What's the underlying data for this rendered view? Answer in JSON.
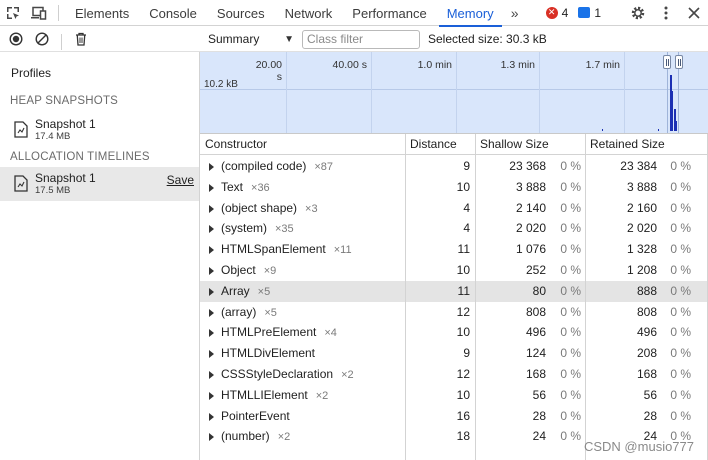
{
  "tabs": [
    {
      "label": "Elements"
    },
    {
      "label": "Console"
    },
    {
      "label": "Sources"
    },
    {
      "label": "Network"
    },
    {
      "label": "Performance"
    },
    {
      "label": "Memory",
      "active": true
    }
  ],
  "more_tabs_icon": "double-chevron-right-icon",
  "error_count": "4",
  "message_count": "1",
  "sidebar": {
    "title": "Profiles",
    "sections": [
      {
        "header": "HEAP SNAPSHOTS",
        "items": [
          {
            "name": "Snapshot 1",
            "size": "17.4 MB"
          }
        ]
      },
      {
        "header": "ALLOCATION TIMELINES",
        "items": [
          {
            "name": "Snapshot 1",
            "size": "17.5 MB",
            "action": "Save"
          }
        ]
      }
    ]
  },
  "toolbar": {
    "view": "Summary",
    "filter_placeholder": "Class filter",
    "selected_size": "Selected size: 30.3 kB"
  },
  "timeline": {
    "ticks": [
      "20.00 s",
      "40.00 s",
      "1.0 min",
      "1.3 min",
      "1.7 min"
    ],
    "y_label": "10.2 kB"
  },
  "table": {
    "columns": [
      "Constructor",
      "Distance",
      "Shallow Size",
      "Retained Size"
    ],
    "rows": [
      {
        "name": "(compiled code)",
        "count": "×87",
        "distance": "9",
        "shallow": "23 368",
        "shallow_pct": "0 %",
        "retained": "23 384",
        "retained_pct": "0 %"
      },
      {
        "name": "Text",
        "count": "×36",
        "distance": "10",
        "shallow": "3 888",
        "shallow_pct": "0 %",
        "retained": "3 888",
        "retained_pct": "0 %"
      },
      {
        "name": "(object shape)",
        "count": "×3",
        "distance": "4",
        "shallow": "2 140",
        "shallow_pct": "0 %",
        "retained": "2 160",
        "retained_pct": "0 %"
      },
      {
        "name": "(system)",
        "count": "×35",
        "distance": "4",
        "shallow": "2 020",
        "shallow_pct": "0 %",
        "retained": "2 020",
        "retained_pct": "0 %"
      },
      {
        "name": "HTMLSpanElement",
        "count": "×11",
        "distance": "11",
        "shallow": "1 076",
        "shallow_pct": "0 %",
        "retained": "1 328",
        "retained_pct": "0 %"
      },
      {
        "name": "Object",
        "count": "×9",
        "distance": "10",
        "shallow": "252",
        "shallow_pct": "0 %",
        "retained": "1 208",
        "retained_pct": "0 %"
      },
      {
        "name": "Array",
        "count": "×5",
        "distance": "11",
        "shallow": "80",
        "shallow_pct": "0 %",
        "retained": "888",
        "retained_pct": "0 %",
        "selected": true
      },
      {
        "name": "(array)",
        "count": "×5",
        "distance": "12",
        "shallow": "808",
        "shallow_pct": "0 %",
        "retained": "808",
        "retained_pct": "0 %"
      },
      {
        "name": "HTMLPreElement",
        "count": "×4",
        "distance": "10",
        "shallow": "496",
        "shallow_pct": "0 %",
        "retained": "496",
        "retained_pct": "0 %"
      },
      {
        "name": "HTMLDivElement",
        "count": "",
        "distance": "9",
        "shallow": "124",
        "shallow_pct": "0 %",
        "retained": "208",
        "retained_pct": "0 %"
      },
      {
        "name": "CSSStyleDeclaration",
        "count": "×2",
        "distance": "12",
        "shallow": "168",
        "shallow_pct": "0 %",
        "retained": "168",
        "retained_pct": "0 %"
      },
      {
        "name": "HTMLLIElement",
        "count": "×2",
        "distance": "10",
        "shallow": "56",
        "shallow_pct": "0 %",
        "retained": "56",
        "retained_pct": "0 %"
      },
      {
        "name": "PointerEvent",
        "count": "",
        "distance": "16",
        "shallow": "28",
        "shallow_pct": "0 %",
        "retained": "28",
        "retained_pct": "0 %"
      },
      {
        "name": "(number)",
        "count": "×2",
        "distance": "18",
        "shallow": "24",
        "shallow_pct": "0 %",
        "retained": "24",
        "retained_pct": "0 %"
      }
    ]
  },
  "watermark": "CSDN @musio777",
  "colors": {
    "accent": "#1a5fd8",
    "error": "#d93025",
    "timeline_bg": "#d9e6fb",
    "selected_row": "#e4e4e4"
  }
}
